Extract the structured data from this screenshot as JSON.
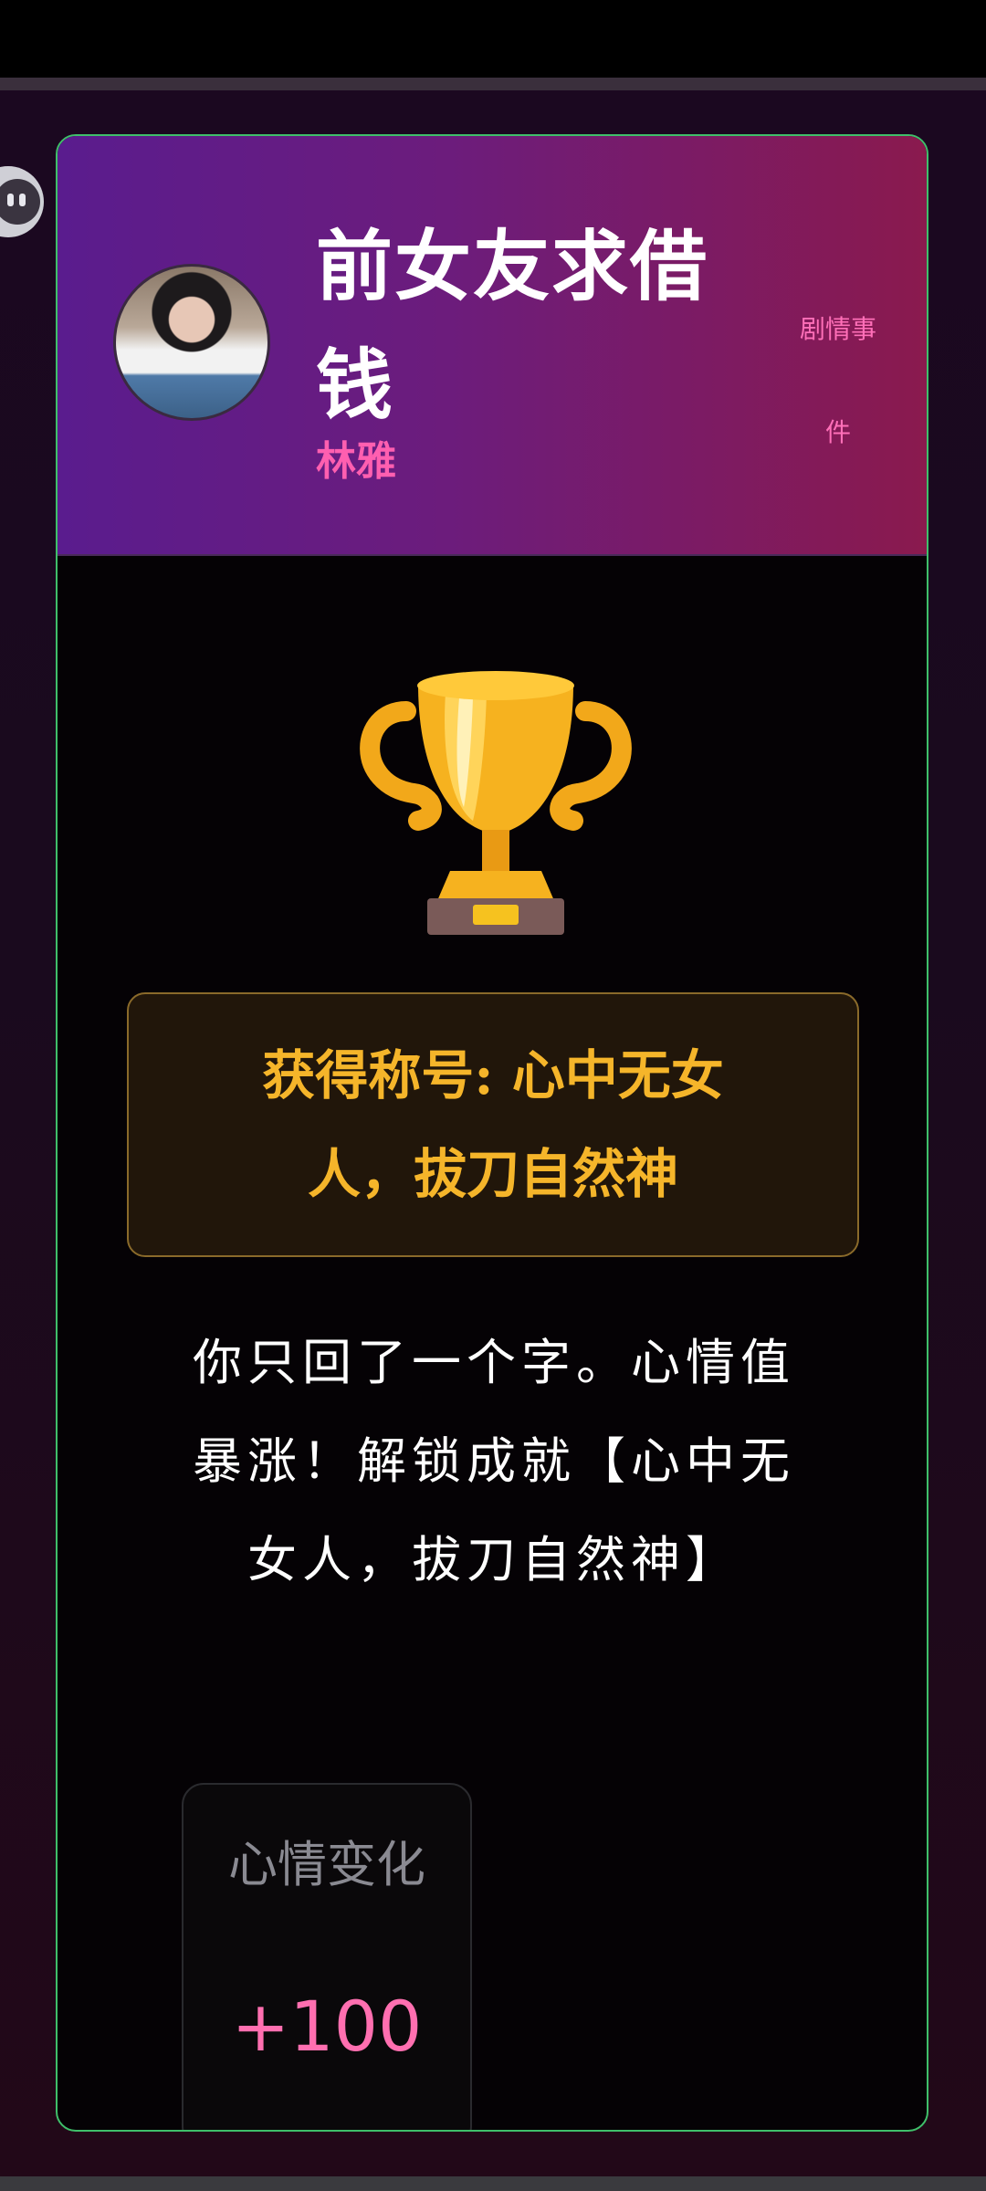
{
  "header": {
    "title": "前女友求借钱",
    "character_name": "林雅",
    "event_tag": "剧情事件"
  },
  "achievement": {
    "text": "获得称号: 心中无女人，拔刀自然神"
  },
  "message": {
    "text": "你只回了一个字。心情值暴涨！解锁成就【心中无女人，拔刀自然神】"
  },
  "stats": {
    "mood_label": "心情变化",
    "mood_value": "+100"
  },
  "icons": {
    "trophy": "trophy-icon",
    "chat": "chat-bubble-icon",
    "avatar": "character-avatar"
  },
  "colors": {
    "card_border": "#3fbf6a",
    "header_start": "#5a1c8e",
    "header_end": "#8a1a4e",
    "accent_pink": "#ff5fb0",
    "achievement_gold": "#f5b52a"
  }
}
